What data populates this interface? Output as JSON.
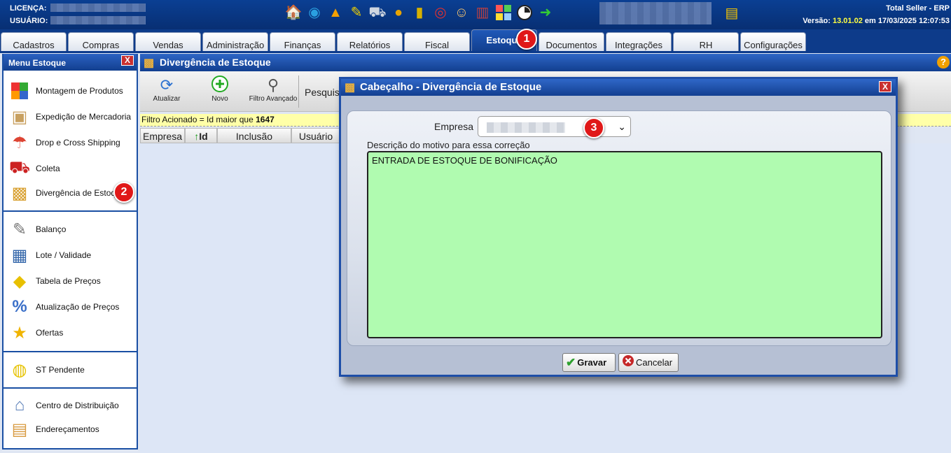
{
  "header": {
    "license_label": "LICENÇA:",
    "user_label": "USUÁRIO:",
    "company": "Total Seller - ERP",
    "version_prefix": "Versão:",
    "version": "13.01.02",
    "version_date": "em 17/03/2025 12:07:53",
    "icons": [
      "home-icon",
      "database-icon",
      "warning-icon",
      "broom-icon",
      "cart-icon",
      "monitor-icon",
      "phone-icon",
      "lifebuoy-icon",
      "users-icon",
      "chart-icon",
      "colors-icon",
      "clock-icon",
      "exit-icon",
      "book-icon"
    ]
  },
  "tabs": [
    "Cadastros",
    "Compras",
    "Vendas",
    "Administração",
    "Finanças",
    "Relatórios",
    "Fiscal",
    "Estoque",
    "Documentos",
    "Integrações",
    "RH",
    "Configurações"
  ],
  "active_tab": "Estoque",
  "badges": {
    "b1": "1",
    "b2": "2",
    "b3": "3"
  },
  "menu": {
    "title": "Menu Estoque",
    "close": "X",
    "items": [
      {
        "label": "Montagem de Produtos",
        "icon": "cube-icon"
      },
      {
        "label": "Expedição de Mercadoria",
        "icon": "box-icon"
      },
      {
        "label": "Drop e Cross Shipping",
        "icon": "parachute-icon"
      },
      {
        "label": "Coleta",
        "icon": "truck-icon"
      },
      {
        "label": "Divergência de Estoque",
        "icon": "open-box-icon"
      },
      {
        "label": "Balanço",
        "icon": "notepad-icon"
      },
      {
        "label": "Lote / Validade",
        "icon": "calendar-icon"
      },
      {
        "label": "Tabela de Preços",
        "icon": "cheese-icon"
      },
      {
        "label": "Atualização de Preços",
        "icon": "percent-icon"
      },
      {
        "label": "Ofertas",
        "icon": "star-icon"
      },
      {
        "label": "ST Pendente",
        "icon": "coins-icon"
      },
      {
        "label": "Centro de Distribuição",
        "icon": "warehouse-icon"
      },
      {
        "label": "Endereçamentos",
        "icon": "shelves-icon"
      }
    ]
  },
  "main": {
    "title": "Divergência de Estoque",
    "toolbar": {
      "refresh": "Atualizar",
      "new": "Novo",
      "advanced_filter": "Filtro Avançado",
      "search": "Pesquisar"
    },
    "filter_text": "Filtro Acionado = Id maior que",
    "filter_value": "1647",
    "columns": [
      "Empresa",
      "Id",
      "Inclusão",
      "Usuário"
    ],
    "sort_arrow": "↑"
  },
  "dialog": {
    "title": "Cabeçalho - Divergência de Estoque",
    "close": "X",
    "company_label": "Empresa",
    "description_label": "Descrição do motivo para essa correção",
    "description_value": "ENTRADA DE ESTOQUE DE BONIFICAÇÃO",
    "save": "Gravar",
    "cancel": "Cancelar"
  }
}
